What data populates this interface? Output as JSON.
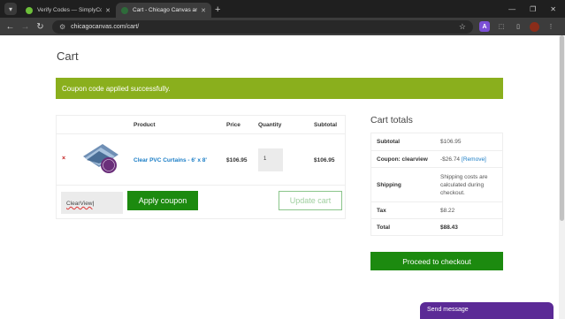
{
  "browser": {
    "tabs": [
      {
        "title": "Verify Codes — SimplyCodes",
        "active": false,
        "favicon_color": "#6dbf3a"
      },
      {
        "title": "Cart - Chicago Canvas and Supply",
        "active": true,
        "favicon_color": "#2e6b3a"
      }
    ],
    "url": "chicagocanvas.com/cart/",
    "extension_badge": "A",
    "icons": [
      "tab-menu-icon",
      "back-icon",
      "forward-icon",
      "reload-icon",
      "bookmark-star-icon",
      "extensions-icon"
    ]
  },
  "page": {
    "heading": "Cart",
    "notice": "Coupon code applied successfully.",
    "table": {
      "headers": {
        "product": "Product",
        "price": "Price",
        "quantity": "Quantity",
        "subtotal": "Subtotal"
      },
      "item": {
        "remove_glyph": "×",
        "name": "Clear PVC Curtains - 6' x 8'",
        "price": "$106.95",
        "quantity": "1",
        "subtotal": "$106.95"
      }
    },
    "coupon_value": "ClearView",
    "apply_coupon_label": "Apply coupon",
    "update_cart_label": "Update cart"
  },
  "totals": {
    "heading": "Cart totals",
    "subtotal_label": "Subtotal",
    "subtotal_value": "$106.95",
    "coupon_label": "Coupon: clearview",
    "coupon_value": "-$26.74",
    "coupon_remove": "[Remove]",
    "shipping_label": "Shipping",
    "shipping_value": "Shipping costs are calculated during checkout.",
    "tax_label": "Tax",
    "tax_value": "$8.22",
    "total_label": "Total",
    "total_value": "$88.43"
  },
  "checkout_label": "Proceed to checkout",
  "chat_label": "Send message",
  "colors": {
    "notice_bg": "#8aaf1d",
    "button_green": "#1c8a0f",
    "link_blue": "#1a7dc6",
    "chat_purple": "#5b2a96"
  }
}
